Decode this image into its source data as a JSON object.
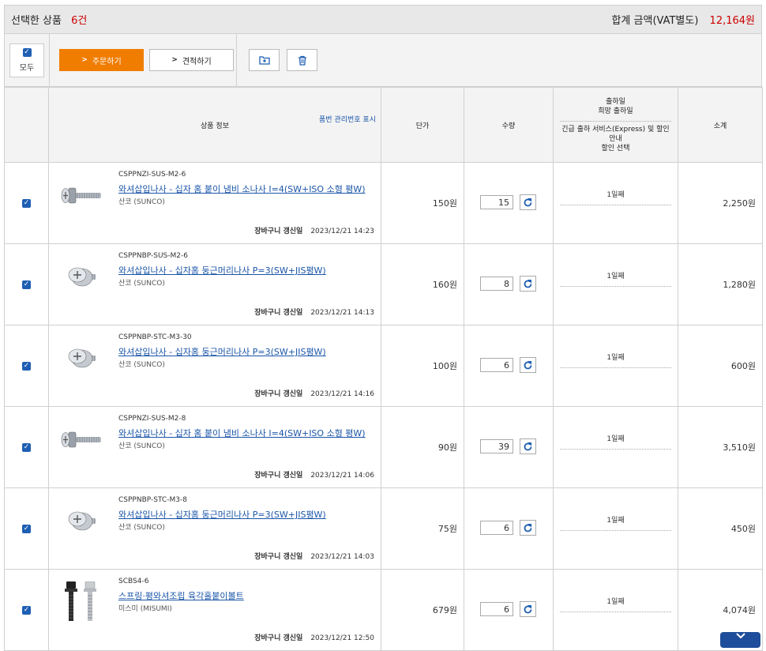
{
  "summary": {
    "selected_label": "선택한 상품",
    "selected_count": "6건",
    "total_label": "합계 금액(VAT별도)",
    "total_amount": "12,164원"
  },
  "toolbar": {
    "all_label": "모두",
    "order_label": "주문하기",
    "quote_label": "견적하기",
    "folder_icon": "add-to-folder-icon",
    "delete_icon": "trash-icon"
  },
  "header": {
    "info": "상품 정보",
    "info_link": "품번 관리번호 표시",
    "price": "단가",
    "qty": "수량",
    "ship_line1": "출하일",
    "ship_line2": "희망 출하일",
    "ship_line3": "긴급 출하 서비스(Express) 및 할인 안내",
    "ship_line4": "할인 선택",
    "subtotal": "소계"
  },
  "rows": [
    {
      "code": "CSPPNZI-SUS-M2-6",
      "name": "와셔삽입나사 - 십자 홈 붙이 냄비 소나사 I=4(SW+ISO 소형 평W)",
      "maker": "산코 (SUNCO)",
      "updated_label": "장바구니 갱신일",
      "updated": "2023/12/21 14:23",
      "price": "150원",
      "qty": "15",
      "ship": "1일째",
      "subtotal": "2,250원",
      "img": "pan-screw"
    },
    {
      "code": "CSPPNBP-SUS-M2-6",
      "name": "와셔삽입나사 - 십자홈 둥근머리나사 P=3(SW+JIS평W)",
      "maker": "산코 (SUNCO)",
      "updated_label": "장바구니 갱신일",
      "updated": "2023/12/21 14:13",
      "price": "160원",
      "qty": "8",
      "ship": "1일째",
      "subtotal": "1,280원",
      "img": "round-screw"
    },
    {
      "code": "CSPPNBP-STC-M3-30",
      "name": "와셔삽입나사 - 십자홈 둥근머리나사 P=3(SW+JIS평W)",
      "maker": "산코 (SUNCO)",
      "updated_label": "장바구니 갱신일",
      "updated": "2023/12/21 14:16",
      "price": "100원",
      "qty": "6",
      "ship": "1일째",
      "subtotal": "600원",
      "img": "round-screw"
    },
    {
      "code": "CSPPNZI-SUS-M2-8",
      "name": "와셔삽입나사 - 십자 홈 붙이 냄비 소나사 I=4(SW+ISO 소형 평W)",
      "maker": "산코 (SUNCO)",
      "updated_label": "장바구니 갱신일",
      "updated": "2023/12/21 14:06",
      "price": "90원",
      "qty": "39",
      "ship": "1일째",
      "subtotal": "3,510원",
      "img": "pan-screw"
    },
    {
      "code": "CSPPNBP-STC-M3-8",
      "name": "와셔삽입나사 - 십자홈 둥근머리나사 P=3(SW+JIS평W)",
      "maker": "산코 (SUNCO)",
      "updated_label": "장바구니 갱신일",
      "updated": "2023/12/21 14:03",
      "price": "75원",
      "qty": "6",
      "ship": "1일째",
      "subtotal": "450원",
      "img": "round-screw"
    },
    {
      "code": "SCBS4-6",
      "name": "스프링·평와셔조립 육각홀붙이볼트",
      "maker": "미스미 (MISUMI)",
      "updated_label": "장바구니 갱신일",
      "updated": "2023/12/21 12:50",
      "price": "679원",
      "qty": "6",
      "ship": "1일째",
      "subtotal": "4,074원",
      "img": "hex-bolt"
    }
  ],
  "colors": {
    "accent": "#f07c00",
    "link": "#1a55a8",
    "price_red": "#cc0000",
    "checkbox": "#1f5fb3"
  }
}
